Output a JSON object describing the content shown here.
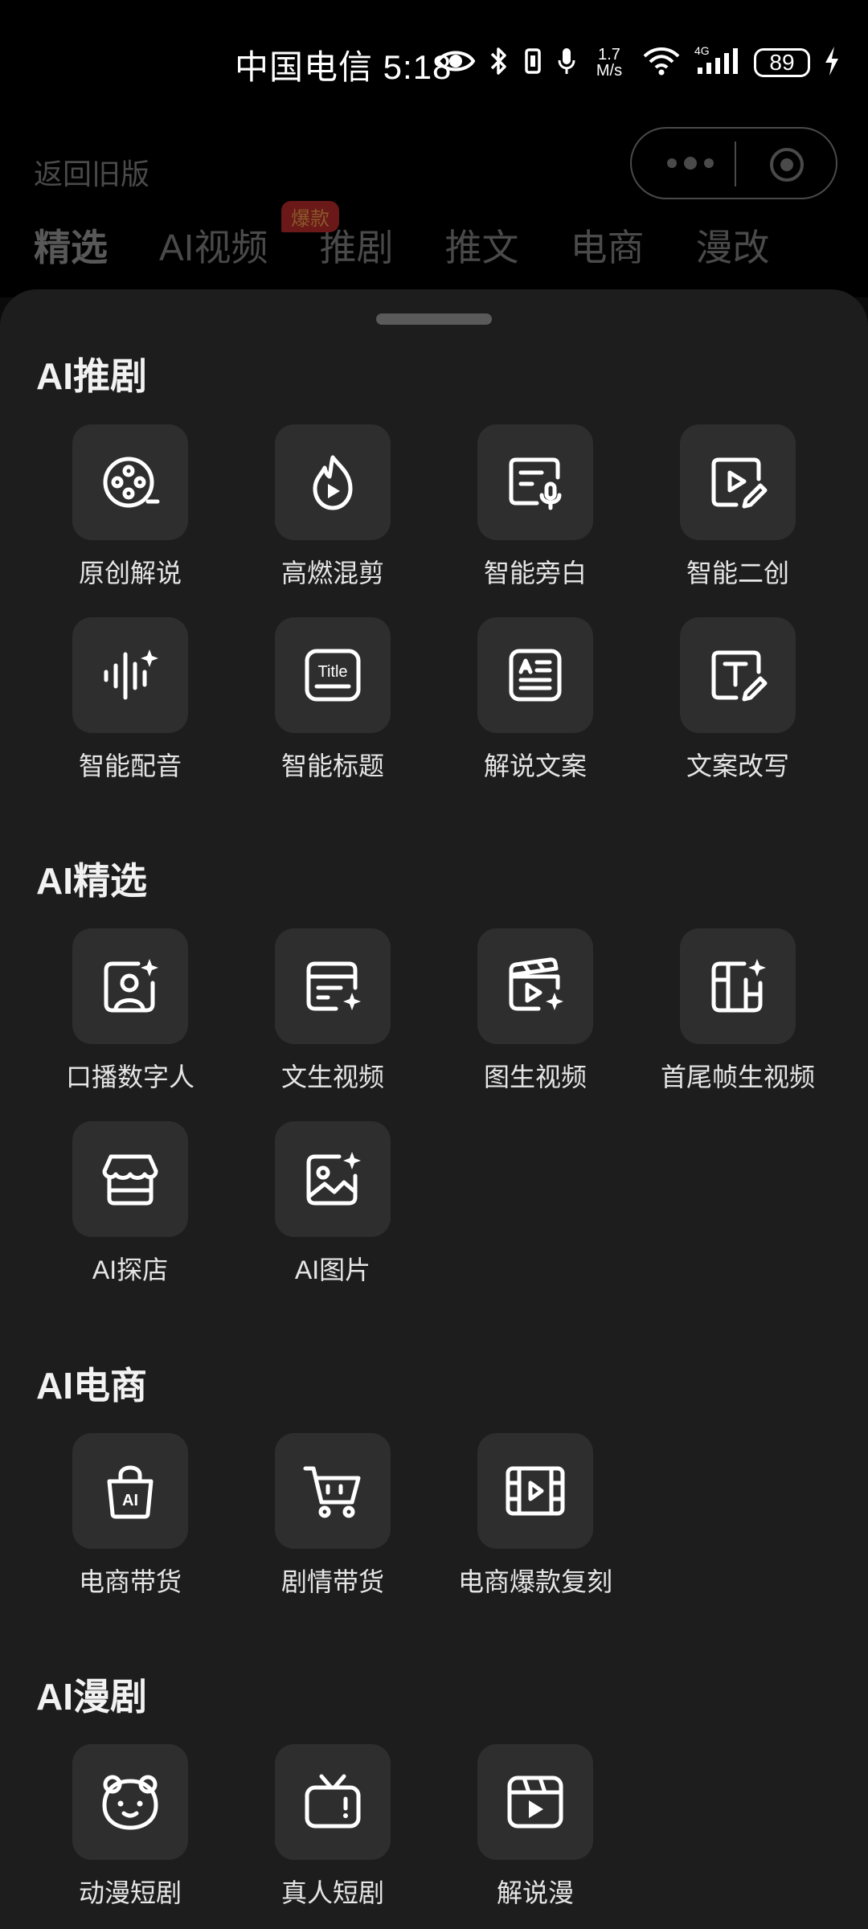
{
  "status_bar": {
    "carrier_time": "中国电信 5:18",
    "net_speed_value": "1.7",
    "net_speed_unit": "M/s",
    "network_type": "4G",
    "battery": "89",
    "icons": [
      "eye-icon",
      "bluetooth-icon",
      "vibrate-icon",
      "mic-icon",
      "wifi-icon",
      "signal-icon",
      "charging-icon"
    ]
  },
  "header": {
    "back_old_label": "返回旧版",
    "tabs": [
      "精选",
      "AI视频",
      "推剧",
      "推文",
      "电商",
      "漫改"
    ],
    "tab_badge": "爆款"
  },
  "sheet": {
    "sections": [
      {
        "title": "AI推剧",
        "items": [
          {
            "label": "原创解说",
            "icon": "film-reel-icon"
          },
          {
            "label": "高燃混剪",
            "icon": "flame-play-icon"
          },
          {
            "label": "智能旁白",
            "icon": "narration-mic-icon"
          },
          {
            "label": "智能二创",
            "icon": "video-edit-icon"
          },
          {
            "label": "智能配音",
            "icon": "voice-wave-icon"
          },
          {
            "label": "智能标题",
            "icon": "title-icon"
          },
          {
            "label": "解说文案",
            "icon": "document-icon"
          },
          {
            "label": "文案改写",
            "icon": "text-edit-icon"
          }
        ]
      },
      {
        "title": "AI精选",
        "items": [
          {
            "label": "口播数字人",
            "icon": "digital-human-icon"
          },
          {
            "label": "文生视频",
            "icon": "text-to-video-icon"
          },
          {
            "label": "图生视频",
            "icon": "image-to-video-icon"
          },
          {
            "label": "首尾帧生视频",
            "icon": "frames-to-video-icon"
          },
          {
            "label": "AI探店",
            "icon": "store-icon"
          },
          {
            "label": "AI图片",
            "icon": "ai-image-icon"
          }
        ]
      },
      {
        "title": "AI电商",
        "items": [
          {
            "label": "电商带货",
            "icon": "ai-bag-icon",
            "icon_text": "AI"
          },
          {
            "label": "剧情带货",
            "icon": "shopping-cart-icon"
          },
          {
            "label": "电商爆款复刻",
            "icon": "film-strip-icon"
          }
        ]
      },
      {
        "title": "AI漫剧",
        "items": [
          {
            "label": "动漫短剧",
            "icon": "bear-face-icon"
          },
          {
            "label": "真人短剧",
            "icon": "tv-icon"
          },
          {
            "label": "解说漫",
            "icon": "clapperboard-icon"
          }
        ]
      }
    ],
    "title_icon_text": "Title"
  }
}
